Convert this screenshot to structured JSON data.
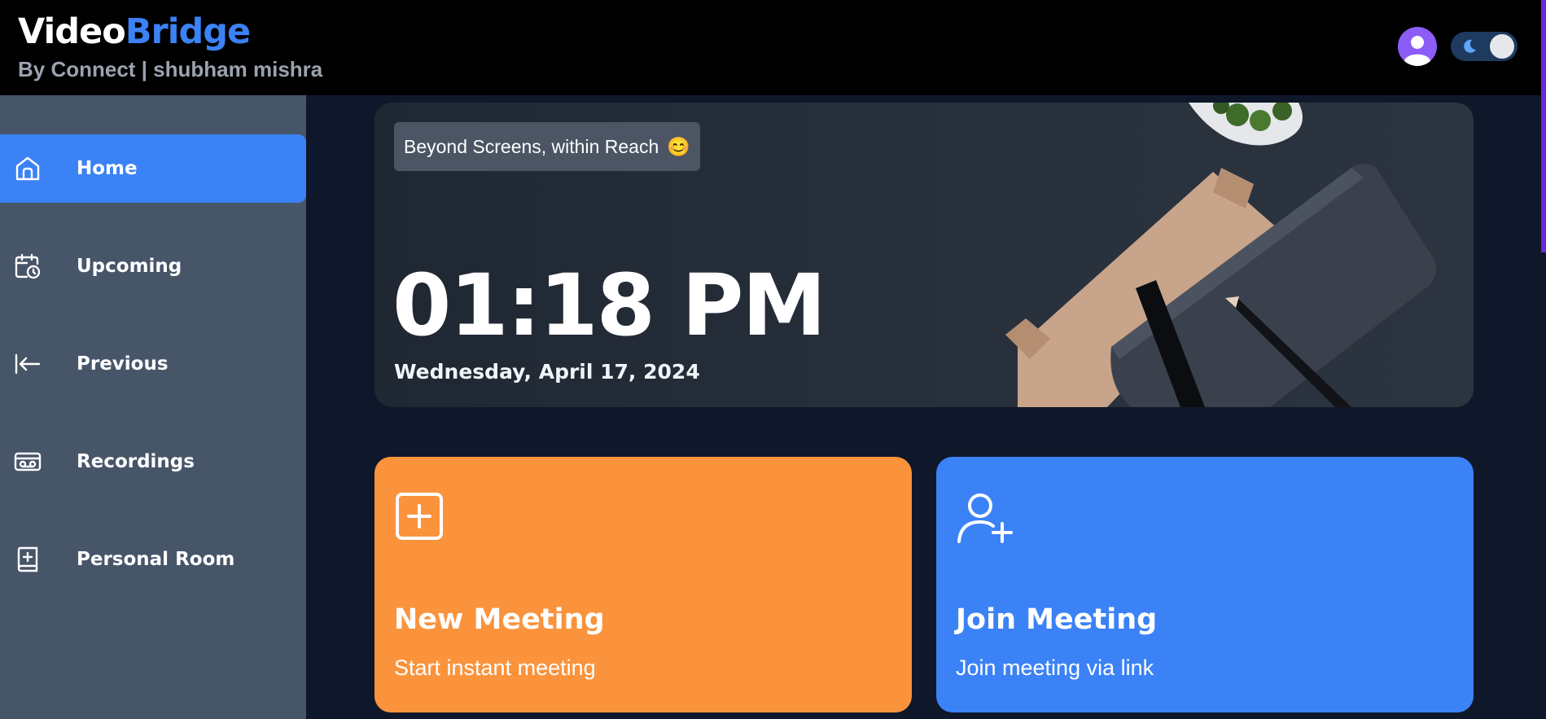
{
  "header": {
    "logo_part1": "Video",
    "logo_part2": "Bridge",
    "byline": "By Connect | shubham mishra",
    "avatar_icon": "user-avatar-icon",
    "theme_toggle_icon": "moon-icon"
  },
  "sidebar": {
    "items": [
      {
        "label": "Home",
        "icon": "home-icon",
        "active": true
      },
      {
        "label": "Upcoming",
        "icon": "calendar-clock-icon",
        "active": false
      },
      {
        "label": "Previous",
        "icon": "arrow-left-to-line-icon",
        "active": false
      },
      {
        "label": "Recordings",
        "icon": "video-cassette-icon",
        "active": false
      },
      {
        "label": "Personal Room",
        "icon": "book-plus-icon",
        "active": false
      }
    ]
  },
  "hero": {
    "tagline": "Beyond Screens, within Reach",
    "tagline_emoji": "😊",
    "time": "01:18 PM",
    "date": "Wednesday, April 17, 2024"
  },
  "cards": [
    {
      "title": "New Meeting",
      "subtitle": "Start instant meeting",
      "icon": "plus-square-icon",
      "color": "#fa933c"
    },
    {
      "title": "Join Meeting",
      "subtitle": "Join meeting via link",
      "icon": "user-plus-icon",
      "color": "#3b82f6"
    }
  ],
  "colors": {
    "accent": "#3b82f6",
    "sidebar": "#475569",
    "background": "#0f172a",
    "header": "#000000"
  }
}
